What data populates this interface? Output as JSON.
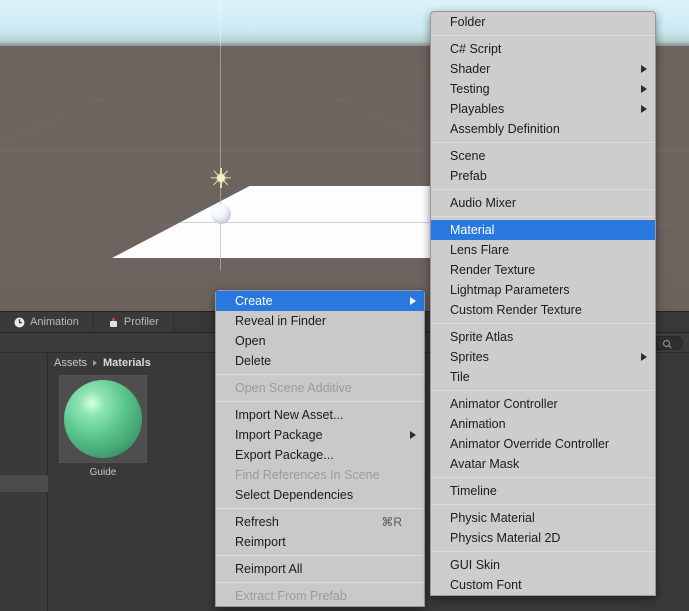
{
  "scene": {
    "name": "unity-scene-view",
    "objects": [
      "directional-light-gizmo",
      "plane",
      "sphere"
    ]
  },
  "tabs": [
    {
      "label": "Animation",
      "icon": "clock-icon"
    },
    {
      "label": "Profiler",
      "icon": "profiler-icon"
    }
  ],
  "project": {
    "search_placeholder": "",
    "search_value": "",
    "breadcrumb": [
      "Assets",
      "Materials"
    ],
    "assets": [
      {
        "name": "Guide",
        "type": "material",
        "color": "#5cc68f"
      }
    ]
  },
  "context_menu": {
    "name": "assets-context-menu",
    "items": [
      {
        "label": "Create",
        "selected": true,
        "submenu": true,
        "shortcut": ""
      },
      {
        "label": "Reveal in Finder",
        "selected": false,
        "submenu": false,
        "shortcut": ""
      },
      {
        "label": "Open",
        "selected": false,
        "submenu": false,
        "shortcut": ""
      },
      {
        "label": "Delete",
        "selected": false,
        "submenu": false,
        "shortcut": ""
      },
      {
        "separator": true
      },
      {
        "label": "Open Scene Additive",
        "disabled": true,
        "submenu": false,
        "shortcut": ""
      },
      {
        "separator": true
      },
      {
        "label": "Import New Asset...",
        "selected": false,
        "submenu": false,
        "shortcut": ""
      },
      {
        "label": "Import Package",
        "selected": false,
        "submenu": true,
        "shortcut": ""
      },
      {
        "label": "Export Package...",
        "selected": false,
        "submenu": false,
        "shortcut": ""
      },
      {
        "label": "Find References In Scene",
        "disabled": true,
        "submenu": false,
        "shortcut": ""
      },
      {
        "label": "Select Dependencies",
        "selected": false,
        "submenu": false,
        "shortcut": ""
      },
      {
        "separator": true
      },
      {
        "label": "Refresh",
        "selected": false,
        "submenu": false,
        "shortcut": "⌘R"
      },
      {
        "label": "Reimport",
        "selected": false,
        "submenu": false,
        "shortcut": ""
      },
      {
        "separator": true
      },
      {
        "label": "Reimport All",
        "selected": false,
        "submenu": false,
        "shortcut": ""
      },
      {
        "separator": true
      },
      {
        "label": "Extract From Prefab",
        "disabled": true,
        "submenu": false,
        "shortcut": ""
      }
    ]
  },
  "create_submenu": {
    "name": "create-submenu",
    "items": [
      {
        "label": "Folder",
        "selected": false,
        "submenu": false
      },
      {
        "separator": true
      },
      {
        "label": "C# Script",
        "selected": false,
        "submenu": false
      },
      {
        "label": "Shader",
        "selected": false,
        "submenu": true
      },
      {
        "label": "Testing",
        "selected": false,
        "submenu": true
      },
      {
        "label": "Playables",
        "selected": false,
        "submenu": true
      },
      {
        "label": "Assembly Definition",
        "selected": false,
        "submenu": false
      },
      {
        "separator": true
      },
      {
        "label": "Scene",
        "selected": false,
        "submenu": false
      },
      {
        "label": "Prefab",
        "selected": false,
        "submenu": false
      },
      {
        "separator": true
      },
      {
        "label": "Audio Mixer",
        "selected": false,
        "submenu": false
      },
      {
        "separator": true
      },
      {
        "label": "Material",
        "selected": true,
        "submenu": false
      },
      {
        "label": "Lens Flare",
        "selected": false,
        "submenu": false
      },
      {
        "label": "Render Texture",
        "selected": false,
        "submenu": false
      },
      {
        "label": "Lightmap Parameters",
        "selected": false,
        "submenu": false
      },
      {
        "label": "Custom Render Texture",
        "selected": false,
        "submenu": false
      },
      {
        "separator": true
      },
      {
        "label": "Sprite Atlas",
        "selected": false,
        "submenu": false
      },
      {
        "label": "Sprites",
        "selected": false,
        "submenu": true
      },
      {
        "label": "Tile",
        "selected": false,
        "submenu": false
      },
      {
        "separator": true
      },
      {
        "label": "Animator Controller",
        "selected": false,
        "submenu": false
      },
      {
        "label": "Animation",
        "selected": false,
        "submenu": false
      },
      {
        "label": "Animator Override Controller",
        "selected": false,
        "submenu": false
      },
      {
        "label": "Avatar Mask",
        "selected": false,
        "submenu": false
      },
      {
        "separator": true
      },
      {
        "label": "Timeline",
        "selected": false,
        "submenu": false
      },
      {
        "separator": true
      },
      {
        "label": "Physic Material",
        "selected": false,
        "submenu": false
      },
      {
        "label": "Physics Material 2D",
        "selected": false,
        "submenu": false
      },
      {
        "separator": true
      },
      {
        "label": "GUI Skin",
        "selected": false,
        "submenu": false
      },
      {
        "label": "Custom Font",
        "selected": false,
        "submenu": false
      }
    ]
  },
  "colors": {
    "menu_bg": "#c9c9c9",
    "menu_highlight": "#2878e0",
    "menu_text": "#1b1b1b",
    "menu_disabled_text": "#9c9c9c",
    "panel_bg": "#383838",
    "scene_ground": "#6f6560",
    "scene_sky": "#d3eef7",
    "material_green": "#5cc68f"
  }
}
